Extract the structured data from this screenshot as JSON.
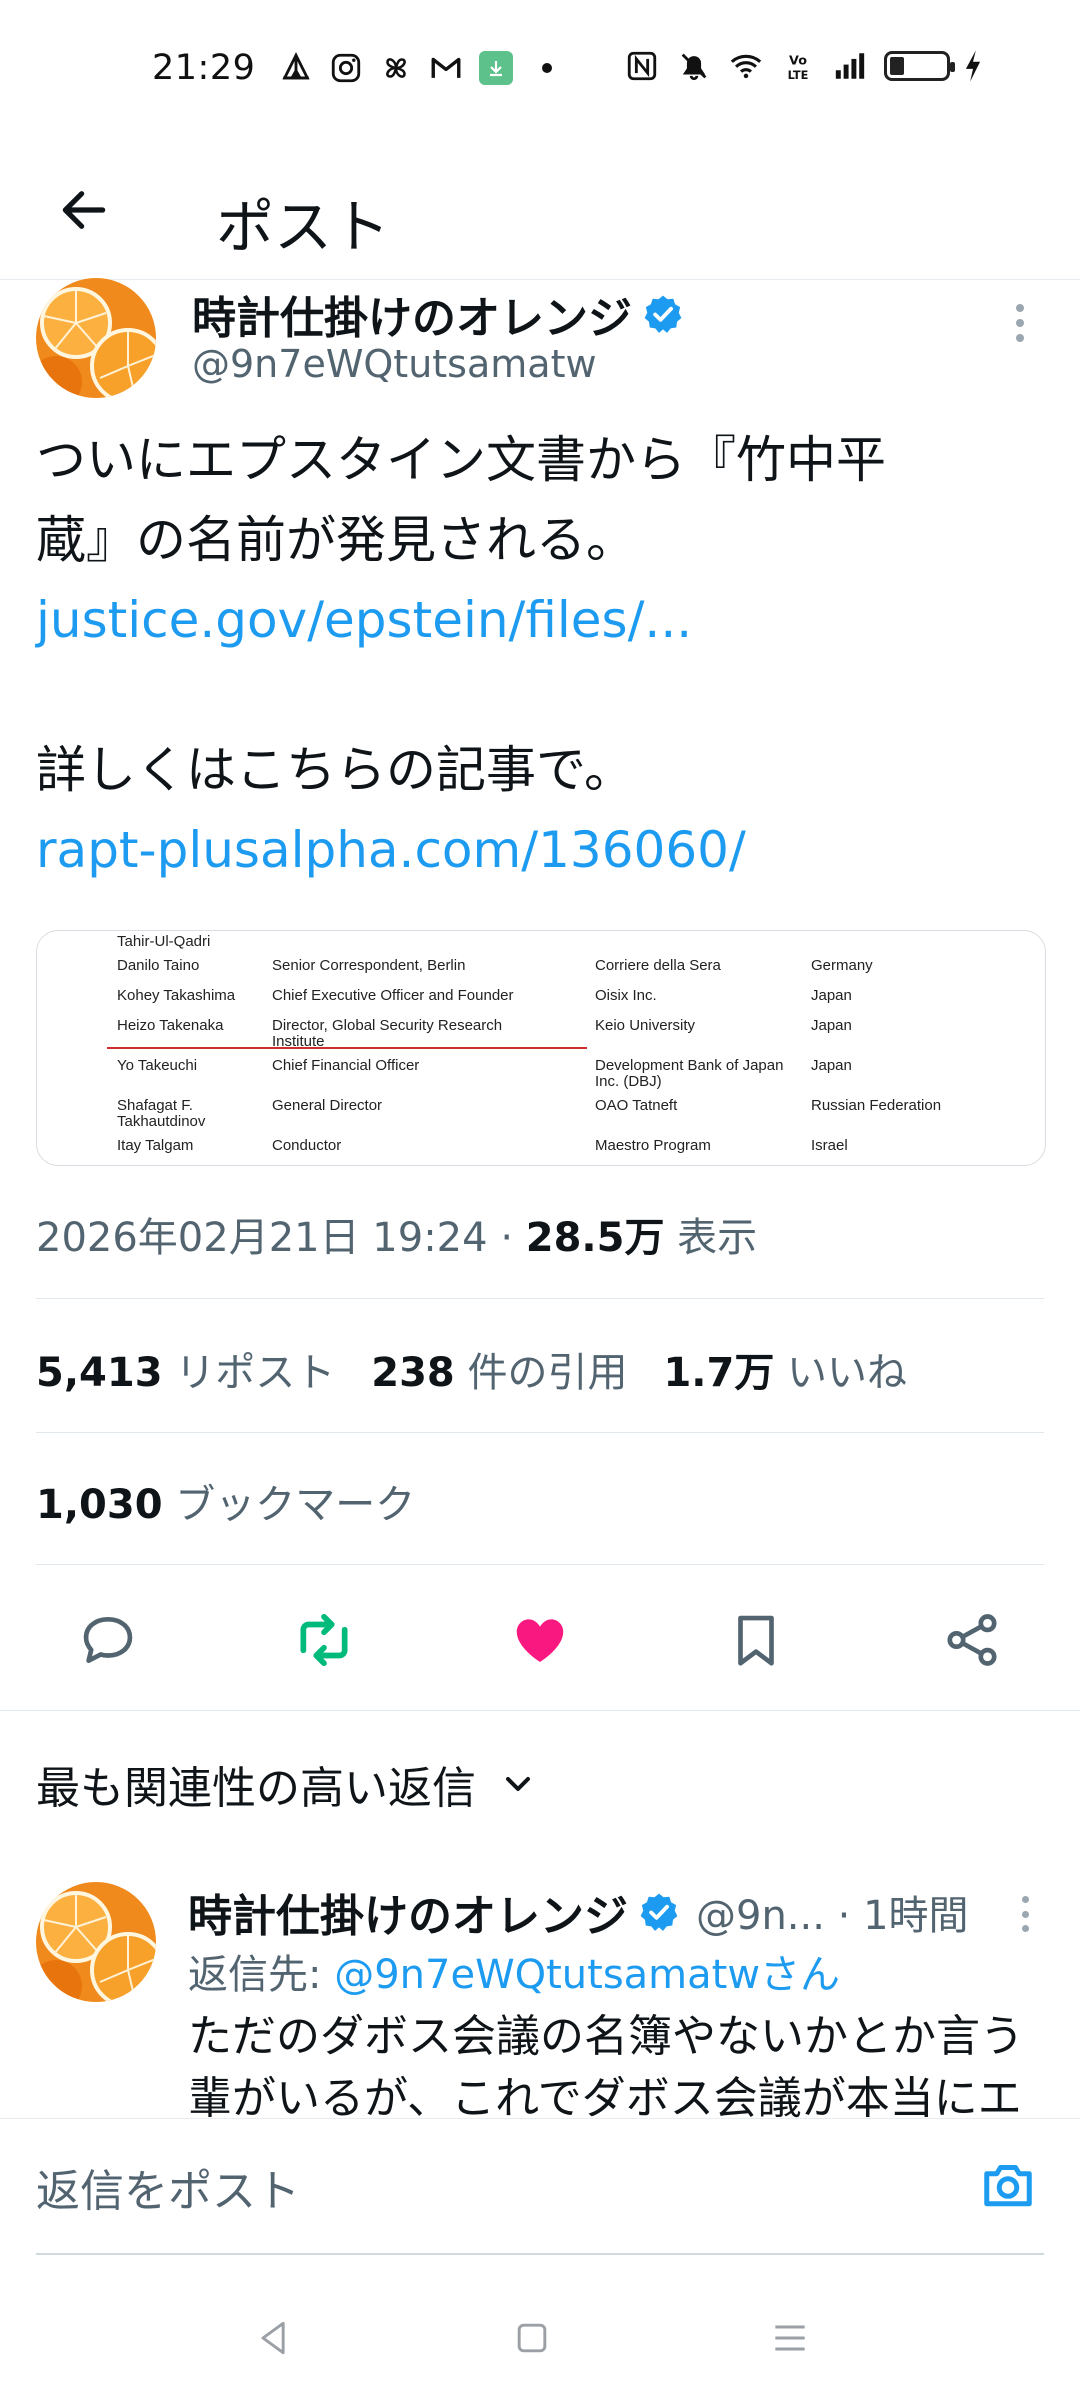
{
  "status_bar": {
    "time": "21:29",
    "left_icons": [
      "camp-icon",
      "instagram-icon",
      "pinwheel-icon",
      "gmail-icon",
      "download-icon",
      "dot-icon"
    ],
    "right_icons": [
      "nfc-icon",
      "mute-icon",
      "wifi-icon",
      "volte-icon",
      "signal-icon",
      "battery-icon",
      "charging-icon"
    ]
  },
  "header": {
    "title": "ポスト"
  },
  "tweet": {
    "author_name": "時計仕掛けのオレンジ",
    "handle": "@9n7eWQtutsamatw",
    "text_lines": [
      "ついにエプスタイン文書から『竹中平",
      "蔵』の名前が発見される。"
    ],
    "link1": "justice.gov/epstein/files/...",
    "text2": "詳しくはこちらの記事で。",
    "link2": "rapt-plusalpha.com/136060/",
    "media": {
      "rows": [
        {
          "name": "Tahir-Ul-Qadri",
          "title": "",
          "org": "",
          "country": ""
        },
        {
          "name": "Danilo Taino",
          "title": "Senior Correspondent, Berlin",
          "org": "Corriere della Sera",
          "country": "Germany"
        },
        {
          "name": "Kohey Takashima",
          "title": "Chief Executive Officer and Founder",
          "org": "Oisix Inc.",
          "country": "Japan"
        },
        {
          "name": "Heizo Takenaka",
          "title": "Director, Global Security Research",
          "title2": "Institute",
          "org": "Keio University",
          "country": "Japan"
        },
        {
          "name": "Yo Takeuchi",
          "title": "Chief Financial Officer",
          "org": "Development Bank of Japan",
          "org2": "Inc. (DBJ)",
          "country": "Japan"
        },
        {
          "name": "Shafagat F.",
          "name2": "Takhautdinov",
          "title": "General Director",
          "org": "OAO Tatneft",
          "country": "Russian Federation"
        },
        {
          "name": "Itay Talgam",
          "title": "Conductor",
          "org": "Maestro Program",
          "country": "Israel"
        }
      ]
    },
    "timestamp": "2026年02月21日 19:24",
    "separator": "·",
    "views_count": "28.5万",
    "views_label": "表示"
  },
  "stats": {
    "reposts_count": "5,413",
    "reposts_label": "リポスト",
    "quotes_count": "238",
    "quotes_label": "件の引用",
    "likes_count": "1.7万",
    "likes_label": "いいね",
    "bookmarks_count": "1,030",
    "bookmarks_label": "ブックマーク"
  },
  "colors": {
    "accent": "#1d9bf0",
    "repost_active": "#00ba7c",
    "like_active": "#f91880",
    "text_secondary": "#536471"
  },
  "sort": {
    "label": "最も関連性の高い返信"
  },
  "reply": {
    "author_name": "時計仕掛けのオレンジ",
    "handle_time": "@9n... · 1時間",
    "reply_to_label": "返信先: ",
    "reply_to_handle": "@9n7eWQtutsamatwさん",
    "text_lines": [
      "ただのダボス会議の名簿やないかとか言う",
      "輩がいるが、これでダボス会議が本当にエ"
    ]
  },
  "composer": {
    "placeholder": "返信をポスト"
  }
}
